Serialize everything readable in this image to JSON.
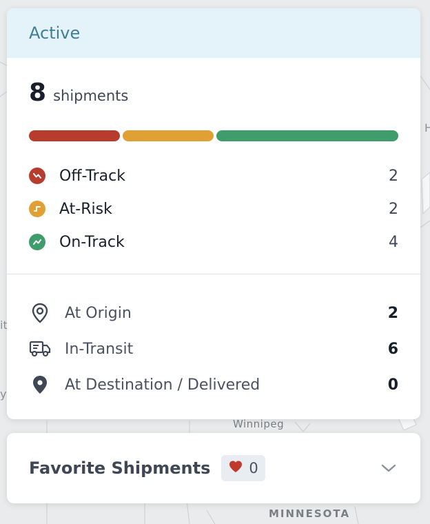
{
  "map": {
    "city_label": "Winnipeg",
    "state_label": "MINNESOTA",
    "edge_letters": [
      "H",
      "it",
      "y"
    ]
  },
  "active_card": {
    "title": "Active",
    "count": "8",
    "count_unit": "shipments",
    "progress": {
      "off_track": 2,
      "at_risk": 2,
      "on_track": 4
    },
    "statuses": [
      {
        "label": "Off-Track",
        "value": "2",
        "color": "#b83c2d",
        "icon": "off-track-icon"
      },
      {
        "label": "At-Risk",
        "value": "2",
        "color": "#e0a033",
        "icon": "at-risk-icon"
      },
      {
        "label": "On-Track",
        "value": "4",
        "color": "#3f9d6b",
        "icon": "on-track-icon"
      }
    ],
    "locations": [
      {
        "label": "At Origin",
        "value": "2",
        "icon": "location-outline-icon"
      },
      {
        "label": "In-Transit",
        "value": "6",
        "icon": "truck-icon"
      },
      {
        "label": "At Destination / Delivered",
        "value": "0",
        "icon": "location-filled-icon"
      }
    ]
  },
  "favorites": {
    "title": "Favorite Shipments",
    "count": "0",
    "heart_color": "#c0392b"
  }
}
